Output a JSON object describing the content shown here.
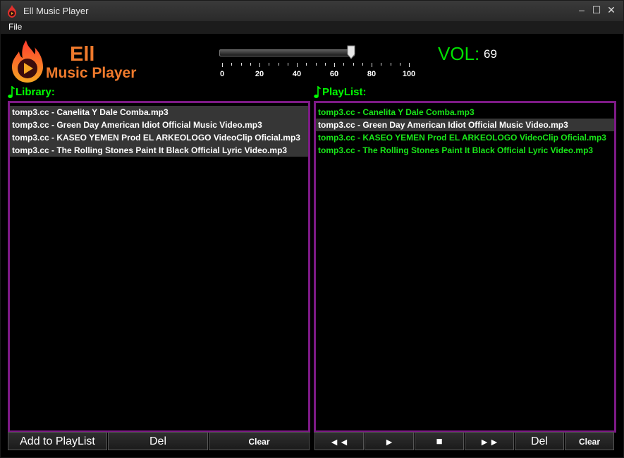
{
  "window": {
    "title": "Ell Music Player"
  },
  "menu": {
    "file": "File"
  },
  "brand": {
    "line1": "Ell",
    "line2": "Music Player"
  },
  "volume": {
    "label": "VOL:",
    "value": "69",
    "level": 69,
    "min": 0,
    "max": 100,
    "tick_labels": [
      "0",
      "20",
      "40",
      "60",
      "80",
      "100"
    ]
  },
  "library": {
    "title": "Library:",
    "items": [
      "tomp3.cc - Canelita  Y Dale Comba.mp3",
      "tomp3.cc - Green Day  American Idiot Official Music Video.mp3",
      "tomp3.cc - KASEO  YEMEN Prod EL ARKEOLOGO VideoClip Oficial.mp3",
      "tomp3.cc - The Rolling Stones  Paint It Black Official Lyric Video.mp3"
    ],
    "buttons": {
      "add": "Add to PlayList",
      "del": "Del",
      "clear": "Clear"
    }
  },
  "playlist": {
    "title": "PlayList:",
    "items": [
      "tomp3.cc - Canelita  Y Dale Comba.mp3",
      "tomp3.cc - Green Day  American Idiot Official Music Video.mp3",
      "tomp3.cc - KASEO  YEMEN Prod EL ARKEOLOGO VideoClip Oficial.mp3",
      "tomp3.cc - The Rolling Stones  Paint It Black Official Lyric Video.mp3"
    ],
    "selected_index": 1,
    "buttons": {
      "prev": "◄◄",
      "play": "►",
      "stop": "■",
      "next": "►►",
      "del": "Del",
      "clear": "Clear"
    }
  },
  "colors": {
    "accent_green": "#00ff00",
    "brand_orange": "#f07a2c",
    "panel_border": "#7d1a86"
  },
  "icons": {
    "app": "flame-play-icon",
    "note": "music-note-icon"
  }
}
